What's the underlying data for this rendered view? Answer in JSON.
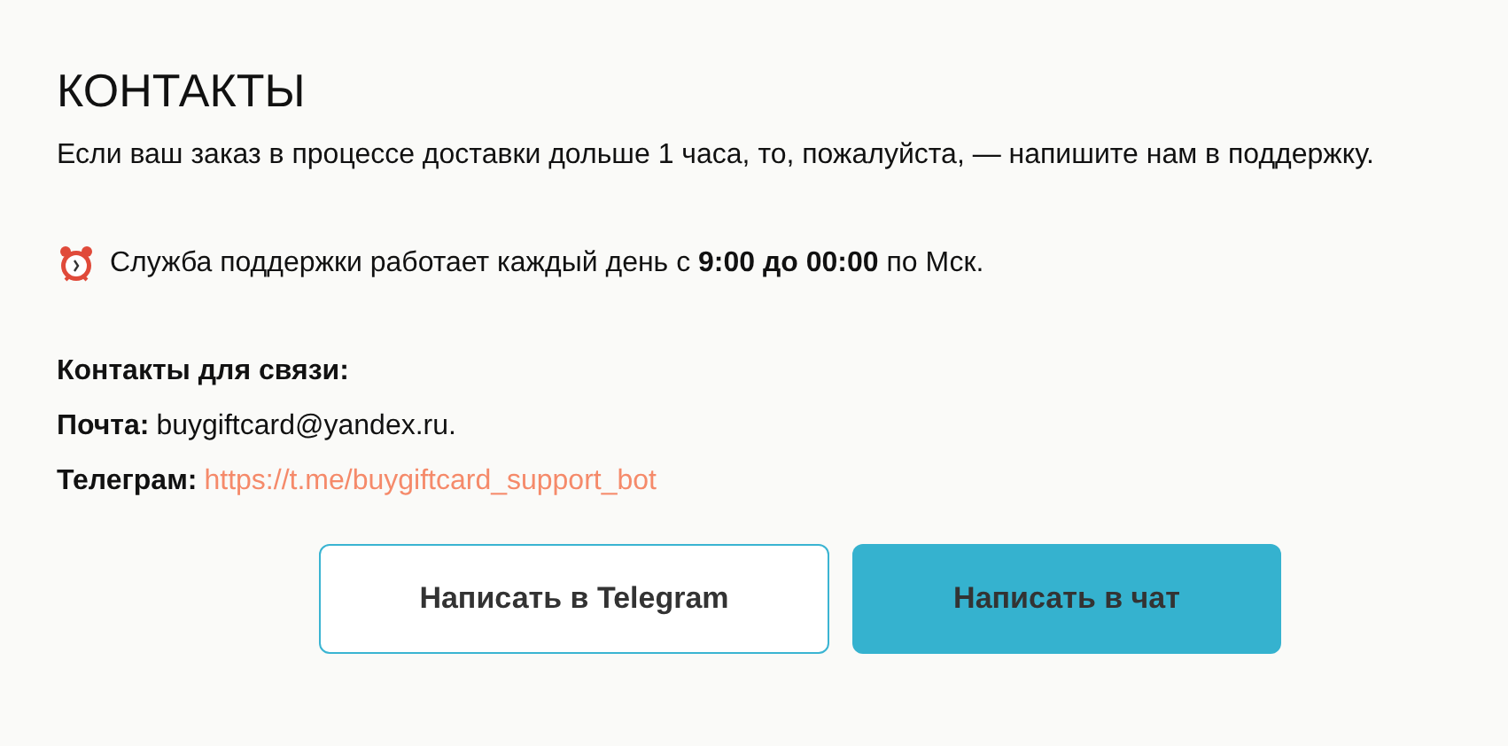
{
  "title": "КОНТАКТЫ",
  "intro": "Если ваш заказ в процессе доставки дольше 1 часа, то, пожалуйста, — напишите нам в поддержку.",
  "hours": "Служба поддержки работает каждый день с **9:00 до 00:00** по Мск.",
  "contacts_heading": "Контакты для связи:",
  "contacts": [
    {
      "label": "Почта:",
      "value": "buygiftcard@yandex.ru.",
      "kind": "text"
    },
    {
      "label": "Телеграм:",
      "value": "https://t.me/buygiftcard_support_bot",
      "kind": "link"
    }
  ],
  "buttons": [
    {
      "label": "Написать в Telegram",
      "kind": "outline"
    },
    {
      "label": "Написать в чат",
      "kind": "filled"
    }
  ]
}
